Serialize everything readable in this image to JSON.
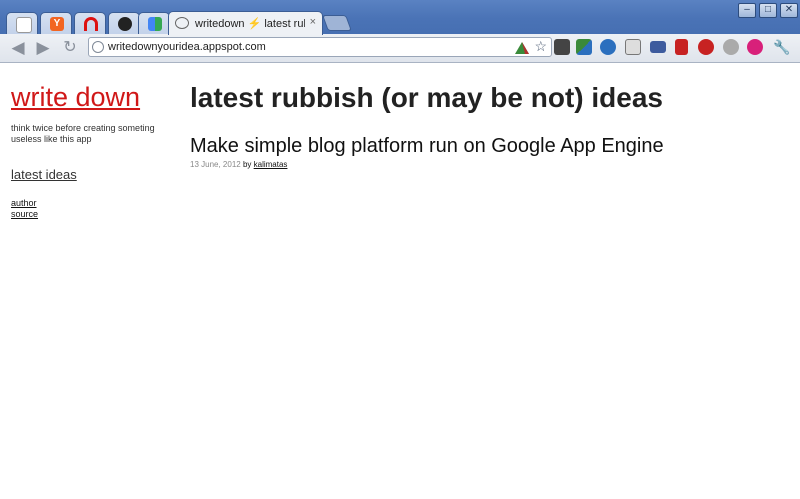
{
  "browser": {
    "tabs": [
      {
        "icon": "reddit-icon",
        "color": "#ffffff"
      },
      {
        "icon": "ycombinator-icon",
        "color": "#f26522"
      },
      {
        "icon": "arc-icon",
        "color": "#d11"
      },
      {
        "icon": "github-icon",
        "color": "#222"
      },
      {
        "icon": "google-icon",
        "color": "#4285f4"
      }
    ],
    "active_tab": {
      "title": "writedown ⚡ latest rubbish (or may be not) ideas",
      "close": "×"
    },
    "url": "writedownyouridea.appspot.com",
    "window_buttons": {
      "minimize": "–",
      "maximize": "□",
      "close": "✕"
    }
  },
  "sidebar": {
    "site_title": "write down",
    "tagline": "think twice before creating someting useless like this app",
    "nav_latest": "latest ideas",
    "links": [
      "author",
      "source"
    ]
  },
  "main": {
    "heading": "latest rubbish (or may be not) ideas",
    "posts": [
      {
        "title": "Make simple blog platform run on Google App Engine",
        "date": "13 June, 2012",
        "by": "by",
        "author": "kalimatas"
      }
    ]
  },
  "colors": {
    "title_red": "#d01818",
    "chrome_blue": "#4a73b6"
  }
}
